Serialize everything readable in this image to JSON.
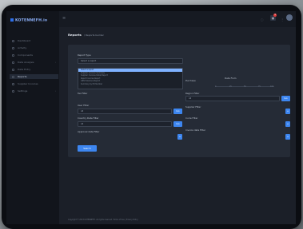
{
  "app": {
    "logo": "KOTENNEFH.io"
  },
  "sidebar": {
    "items": [
      {
        "label": "Dashboard",
        "chevron": ""
      },
      {
        "label": "Activity",
        "chevron": ""
      },
      {
        "label": "Components",
        "chevron": ""
      },
      {
        "label": "Data Analysis",
        "chevron": "›"
      },
      {
        "label": "Data Entry",
        "chevron": ""
      },
      {
        "label": "Reports",
        "chevron": ""
      },
      {
        "label": "Supplier Invoices",
        "chevron": ""
      },
      {
        "label": "Settings",
        "chevron": "›"
      }
    ]
  },
  "header": {
    "badge": "3"
  },
  "breadcrumb": {
    "title": "Reports",
    "sub": "/ Reports builder"
  },
  "form": {
    "report_type_label": "Report Type",
    "report_type_value": "Select a report",
    "dropdown_options": [
      "Select a report",
      "Supplier Invoices Summary",
      "Supplier Invoices Detail Report",
      "Reject Invoices Report",
      "GRN Tolerance Report",
      "Summary by PO Number"
    ],
    "purchase_label": "Purchase",
    "date_from_label": "Date From",
    "slider_ticks": [
      "0",
      "25",
      "50",
      "75",
      "100"
    ],
    "tax_filter_label": "Tax Filter",
    "region_filter_label": "Region Filter",
    "region_value": "All",
    "user_filter_label": "User Filter",
    "user_value": "All",
    "supplier_filter_label": "Supplier Filter",
    "country_filter_label": "Country Date Filter",
    "country_value": "All",
    "currency_filter_label": "Curre Filter",
    "approval_filter_label": "Approval date Filter",
    "invoice_filter_label": "Invoice date Filter",
    "go_label": "Go",
    "plus_label": "+",
    "search_label": "Search"
  },
  "footer": "Copyright © 2023 KOTENNEFH. All rights reserved. Terms of Use | Privacy Policy"
}
